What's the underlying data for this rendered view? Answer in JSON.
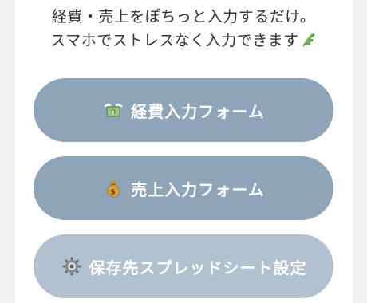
{
  "intro": {
    "line1": "経費・売上をぽちっと入力するだけ。",
    "line2": "スマホでストレスなく入力できます",
    "leaf_icon": "herb-leaf-icon"
  },
  "buttons": [
    {
      "label": "経費入力フォーム",
      "icon": "money-with-wings-icon"
    },
    {
      "label": "売上入力フォーム",
      "icon": "money-bag-icon"
    },
    {
      "label": "保存先スプレッドシート設定",
      "icon": "gear-icon"
    }
  ],
  "colors": {
    "primary_button": "#8ea4b9",
    "disabled_button": "#b1c1cf",
    "text": "#333333",
    "leaf": "#6aa84f"
  }
}
